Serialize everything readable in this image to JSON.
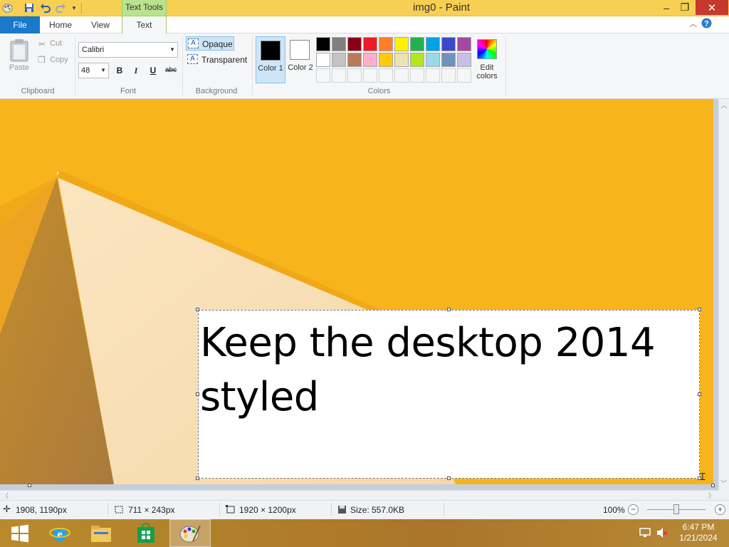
{
  "window": {
    "title": "img0 - Paint",
    "contextual_tab": "Text Tools",
    "minimize": "–",
    "restore": "❐",
    "close": "✕"
  },
  "tabs": {
    "file": "File",
    "home": "Home",
    "view": "View",
    "text": "Text"
  },
  "clipboard": {
    "paste": "Paste",
    "cut": "Cut",
    "copy": "Copy",
    "group": "Clipboard"
  },
  "font": {
    "family": "Calibri",
    "size": "48",
    "bold": "B",
    "italic": "I",
    "underline": "U",
    "strike": "abc",
    "group": "Font"
  },
  "background": {
    "opaque": "Opaque",
    "transparent": "Transparent",
    "group": "Background",
    "icon_glyph": "A"
  },
  "colors": {
    "color1_label": "Color 1",
    "color2_label": "Color 2",
    "edit_label": "Edit colors",
    "group": "Colors",
    "color1": "#000000",
    "color2": "#ffffff",
    "palette_row1": [
      "#000000",
      "#7f7f7f",
      "#880015",
      "#ed1c24",
      "#ff7f27",
      "#fff200",
      "#22b14c",
      "#00a2e8",
      "#3f48cc",
      "#a349a4"
    ],
    "palette_row2": [
      "#ffffff",
      "#c3c3c3",
      "#b97a57",
      "#ffaec9",
      "#ffc90e",
      "#efe4b0",
      "#b5e61d",
      "#99d9ea",
      "#7092be",
      "#c8bfe7"
    ],
    "palette_row3": [
      "#f5f6f7",
      "#f5f6f7",
      "#f5f6f7",
      "#f5f6f7",
      "#f5f6f7",
      "#f5f6f7",
      "#f5f6f7",
      "#f5f6f7",
      "#f5f6f7",
      "#f5f6f7"
    ]
  },
  "textbox": {
    "line1": "Keep the desktop 2014",
    "line2": "styled"
  },
  "status": {
    "cursor": "1908, 1190px",
    "selection": "711 × 243px",
    "image_size": "1920 × 1200px",
    "file_size": "Size: 557.0KB",
    "zoom": "100%"
  },
  "taskbar": {
    "time": "6:47 PM",
    "date": "1/21/2024"
  }
}
